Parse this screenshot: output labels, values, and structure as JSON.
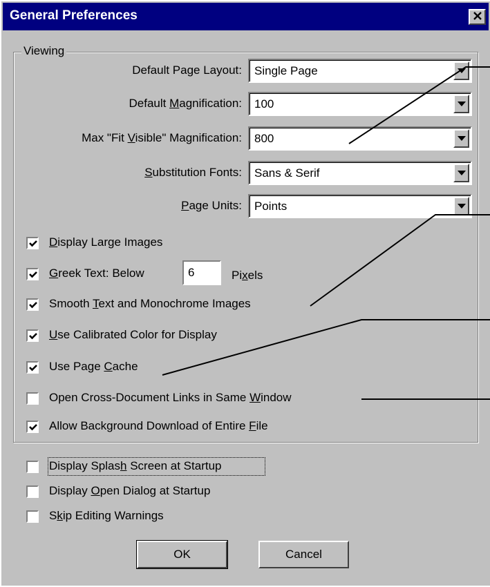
{
  "window": {
    "title": "General Preferences",
    "close_glyph": "✕"
  },
  "viewing": {
    "group_label": "Viewing",
    "fields": [
      {
        "label_pre": "Default Page Layout:",
        "label_ul": "",
        "label_post": "",
        "value": "Single Page"
      },
      {
        "label_pre": "Default ",
        "label_ul": "M",
        "label_post": "agnification:",
        "value": "100"
      },
      {
        "label_pre": "Max \"Fit ",
        "label_ul": "V",
        "label_post": "isible\" Magnification:",
        "value": "800"
      },
      {
        "label_pre": "",
        "label_ul": "S",
        "label_post": "ubstitution Fonts:",
        "value": "Sans & Serif"
      },
      {
        "label_pre": "",
        "label_ul": "P",
        "label_post": "age Units:",
        "value": "Points"
      }
    ],
    "checks": [
      {
        "pre": "",
        "ul": "D",
        "post": "isplay Large Images",
        "checked": true
      },
      {
        "pre": "",
        "ul": "G",
        "post": "reek Text: Below",
        "checked": true
      },
      {
        "pre": "Smooth ",
        "ul": "T",
        "post": "ext and Monochrome Images",
        "checked": true
      },
      {
        "pre": "",
        "ul": "U",
        "post": "se Calibrated Color for Display",
        "checked": true
      },
      {
        "pre": "Use Page ",
        "ul": "C",
        "post": "ache",
        "checked": true
      },
      {
        "pre": "Open Cross-Document Links in Same ",
        "ul": "W",
        "post": "indow",
        "checked": false
      },
      {
        "pre": "Allow Background Download of Entire ",
        "ul": "F",
        "post": "ile",
        "checked": true
      }
    ],
    "greek_value": "6",
    "pixels_pre": "Pi",
    "pixels_ul": "x",
    "pixels_post": "els"
  },
  "startup": [
    {
      "pre": "Display Splas",
      "ul": "h",
      "post": " Screen at Startup",
      "checked": false
    },
    {
      "pre": "Display ",
      "ul": "O",
      "post": "pen Dialog at Startup",
      "checked": false
    },
    {
      "pre": "S",
      "ul": "k",
      "post": "ip Editing Warnings",
      "checked": false
    }
  ],
  "buttons": {
    "ok": "OK",
    "cancel": "Cancel"
  }
}
